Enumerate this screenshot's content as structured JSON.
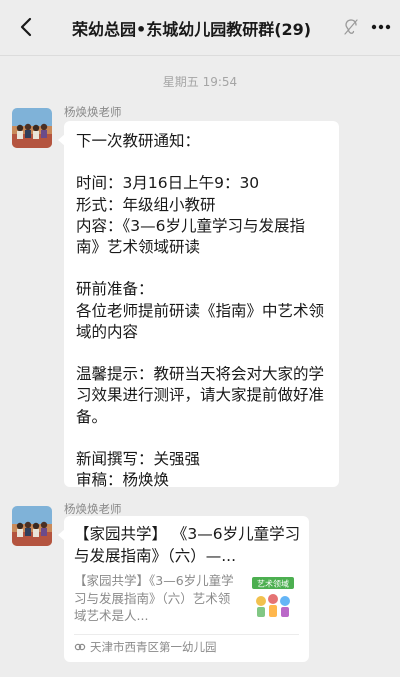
{
  "header": {
    "title": "荣幼总园•东城幼儿园教研群(29)",
    "back_icon": "chevron-left-icon",
    "mute_icon": "ear-muted-icon",
    "more_icon": "more-dots-icon"
  },
  "chat": {
    "timestamp": "星期五 19:54",
    "messages": [
      {
        "sender": "杨焕焕老师",
        "text": "下一次教研通知：\n\n时间：3月16日上午9：30\n形式：年级组小教研\n内容：《3—6岁儿童学习与发展指南》艺术领域研读\n\n研前准备：\n各位老师提前研读《指南》中艺术领域的内容\n\n温馨提示：教研当天将会对大家的学习效果进行测评，请大家提前做好准备。\n\n新闻撰写：关强强\n审稿：杨焕焕"
      },
      {
        "sender": "杨焕焕老师",
        "card": {
          "title": "【家园共学】 《3—6岁儿童学习与发展指南》（六）—...",
          "description": "【家园共学】《3—6岁儿童学习与发展指南》（六）艺术领域艺术是人...",
          "thumb_label": "艺术领域",
          "source": "天津市西青区第一幼儿园",
          "source_icon": "mini-program-icon"
        }
      }
    ]
  },
  "colors": {
    "background": "#ededed",
    "bubble": "#ffffff",
    "meta_text": "#a5a5a5",
    "sender_text": "#8a8a8a",
    "thumb_green": "#4caf50"
  }
}
